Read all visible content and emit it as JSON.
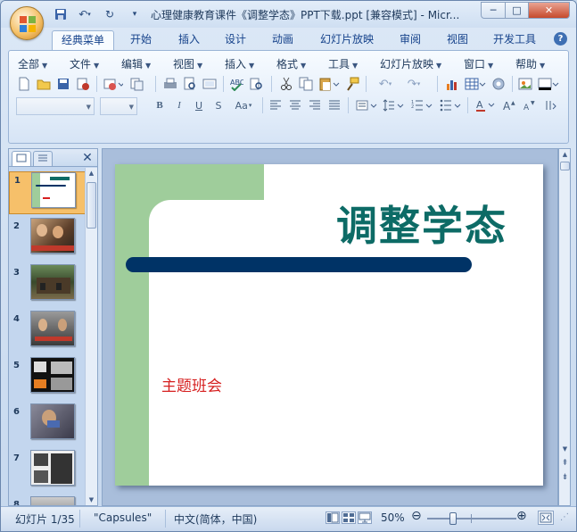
{
  "window": {
    "title": "心理健康教育课件《调整学态》PPT下载.ppt [兼容模式] - Micr...",
    "controls": {
      "minimize": "─",
      "maximize": "□",
      "close": "✕"
    }
  },
  "quick_access": {
    "customize": "▾"
  },
  "ribbon_tabs": [
    {
      "label": "经典菜单"
    },
    {
      "label": "开始"
    },
    {
      "label": "插入"
    },
    {
      "label": "设计"
    },
    {
      "label": "动画"
    },
    {
      "label": "幻灯片放映"
    },
    {
      "label": "审阅"
    },
    {
      "label": "视图"
    },
    {
      "label": "开发工具"
    }
  ],
  "help": {
    "label": "?"
  },
  "classic_menu": [
    {
      "label": "全部"
    },
    {
      "label": "文件"
    },
    {
      "label": "编辑"
    },
    {
      "label": "视图"
    },
    {
      "label": "插入"
    },
    {
      "label": "格式"
    },
    {
      "label": "工具"
    },
    {
      "label": "幻灯片放映"
    },
    {
      "label": "窗口"
    },
    {
      "label": "帮助"
    }
  ],
  "format_buttons": {
    "bold": "B",
    "italic": "I",
    "underline": "U",
    "strike": "S",
    "case": "Aa"
  },
  "slides_pane": {
    "slide_numbers": [
      "1",
      "2",
      "3",
      "4",
      "5",
      "6",
      "7",
      "8"
    ]
  },
  "slide": {
    "title": "调整学态",
    "subtitle": "主题班会",
    "colors": {
      "green": "#9fcd9b",
      "title": "#0d6b66",
      "bar": "#003366",
      "subtitle": "#d62020"
    }
  },
  "status": {
    "slide_info": "幻灯片 1/35",
    "theme": "\"Capsules\"",
    "language": "中文(简体，中国)",
    "zoom": "50%",
    "zoom_level": 0.5
  }
}
